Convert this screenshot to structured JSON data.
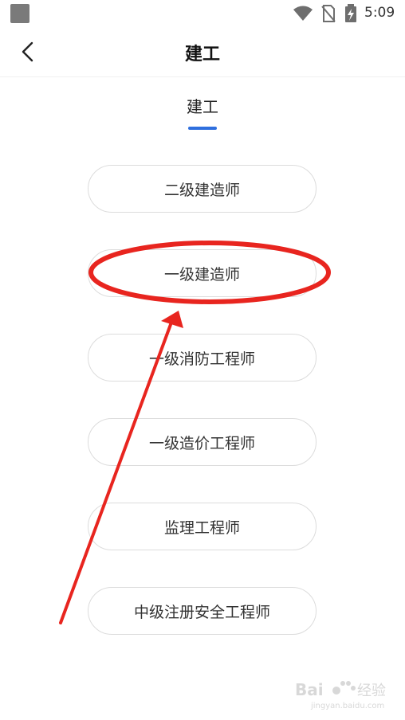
{
  "status_bar": {
    "time": "5:09",
    "icons": [
      "app-square-icon",
      "wifi-icon",
      "no-sim-icon",
      "battery-charging-icon"
    ]
  },
  "header": {
    "back_icon": "chevron-left-icon",
    "title": "建工"
  },
  "tabs": [
    {
      "label": "建工",
      "active": true
    }
  ],
  "options": [
    {
      "label": "二级建造师"
    },
    {
      "label": "一级建造师"
    },
    {
      "label": "一级消防工程师"
    },
    {
      "label": "一级造价工程师"
    },
    {
      "label": "监理工程师"
    },
    {
      "label": "中级注册安全工程师"
    }
  ],
  "colors": {
    "accent": "#2f6fde",
    "annotation": "#e8251f"
  },
  "watermark": {
    "brand": "Bai",
    "brand2": "经验",
    "url": "jingyan.baidu.com"
  }
}
